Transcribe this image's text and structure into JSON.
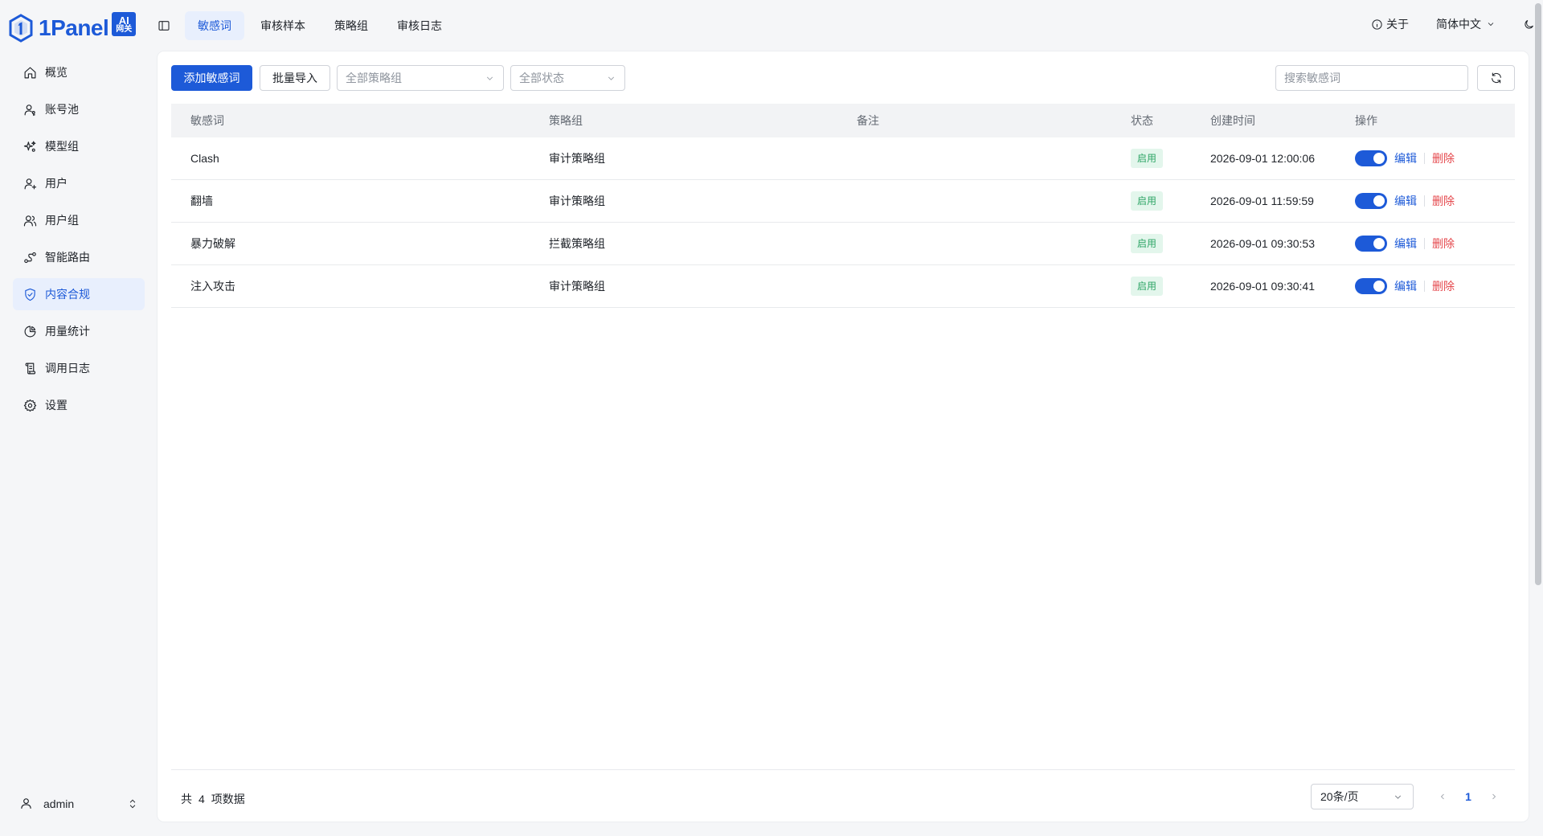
{
  "app": {
    "logo_text": "1Panel",
    "logo_badge_line1": "AI",
    "logo_badge_line2": "网关",
    "brand_color": "#1d5ad8"
  },
  "sidebar": {
    "items": [
      {
        "label": "概览",
        "icon": "home-icon"
      },
      {
        "label": "账号池",
        "icon": "user-key-icon"
      },
      {
        "label": "模型组",
        "icon": "sparkles-icon"
      },
      {
        "label": "用户",
        "icon": "user-plus-icon"
      },
      {
        "label": "用户组",
        "icon": "users-icon"
      },
      {
        "label": "智能路由",
        "icon": "route-icon"
      },
      {
        "label": "内容合规",
        "icon": "shield-check-icon",
        "active": true
      },
      {
        "label": "用量统计",
        "icon": "pie-chart-icon"
      },
      {
        "label": "调用日志",
        "icon": "scroll-icon"
      },
      {
        "label": "设置",
        "icon": "gear-icon"
      }
    ],
    "user": {
      "name": "admin"
    }
  },
  "header": {
    "tabs": [
      {
        "label": "敏感词",
        "active": true
      },
      {
        "label": "审核样本"
      },
      {
        "label": "策略组"
      },
      {
        "label": "审核日志"
      }
    ],
    "about": "关于",
    "language": "简体中文"
  },
  "toolbar": {
    "add_label": "添加敏感词",
    "import_label": "批量导入",
    "policy_select": "全部策略组",
    "status_select": "全部状态",
    "search_placeholder": "搜索敏感词"
  },
  "table": {
    "columns": [
      "敏感词",
      "策略组",
      "备注",
      "状态",
      "创建时间",
      "操作"
    ],
    "rows": [
      {
        "word": "Clash",
        "group": "审计策略组",
        "note": "",
        "status": "启用",
        "created": "2026-09-01 12:00:06",
        "enabled": true
      },
      {
        "word": "翻墙",
        "group": "审计策略组",
        "note": "",
        "status": "启用",
        "created": "2026-09-01 11:59:59",
        "enabled": true
      },
      {
        "word": "暴力破解",
        "group": "拦截策略组",
        "note": "",
        "status": "启用",
        "created": "2026-09-01 09:30:53",
        "enabled": true
      },
      {
        "word": "注入攻击",
        "group": "审计策略组",
        "note": "",
        "status": "启用",
        "created": "2026-09-01 09:30:41",
        "enabled": true
      }
    ],
    "actions": {
      "edit": "编辑",
      "delete": "删除"
    }
  },
  "footer": {
    "total_prefix": "共",
    "total_count": "4",
    "total_suffix": "项数据",
    "page_size": "20条/页",
    "current_page": "1"
  }
}
